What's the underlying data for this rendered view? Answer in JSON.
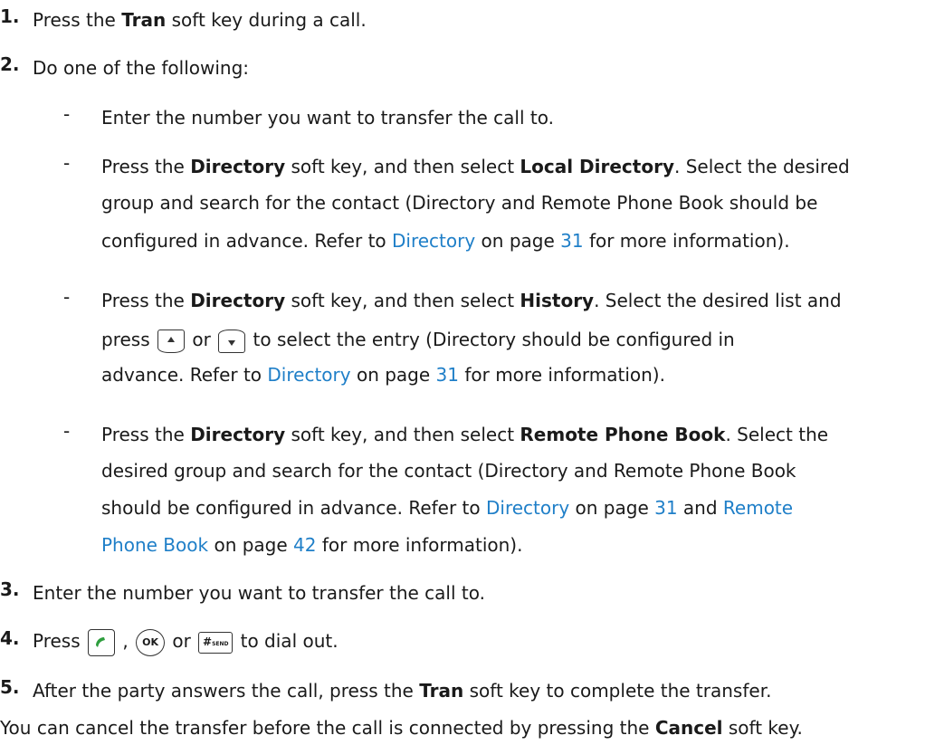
{
  "steps": {
    "s1": {
      "num": "1.",
      "pre": "Press the ",
      "bold": "Tran",
      "post": " soft key during a call."
    },
    "s2": {
      "num": "2.",
      "text": "Do one of the following:"
    },
    "opt1": {
      "dash": "-",
      "text": "Enter the number you want to transfer the call to."
    },
    "opt2": {
      "dash": "-",
      "l1_pre": "Press the ",
      "l1_b1": "Directory",
      "l1_mid": " soft key, and then select ",
      "l1_b2": "Local Directory",
      "l1_post": ". Select the desired",
      "l2": "group and search for the contact (Directory and Remote Phone Book should be",
      "l3_pre": "configured in advance. Refer to ",
      "l3_link": "Directory",
      "l3_mid": " on page ",
      "l3_page": "31",
      "l3_post": " for more information)."
    },
    "opt3": {
      "dash": "-",
      "l1_pre": "Press the ",
      "l1_b1": "Directory",
      "l1_mid": " soft key, and then select ",
      "l1_b2": "History",
      "l1_post": ". Select the desired list and",
      "l2_pre": "press ",
      "l2_or": " or ",
      "l2_post": " to select the entry (Directory should be configured in",
      "l3_pre": "advance. Refer to ",
      "l3_link": "Directory",
      "l3_mid": " on page ",
      "l3_page": "31",
      "l3_post": " for more information)."
    },
    "opt4": {
      "dash": "-",
      "l1_pre": "Press the ",
      "l1_b1": "Directory",
      "l1_mid": " soft key, and then select ",
      "l1_b2": "Remote Phone Book",
      "l1_post": ". Select the",
      "l2": "desired group and search for the contact (Directory and Remote Phone Book",
      "l3_pre": "should be configured in advance. Refer to ",
      "l3_link": "Directory",
      "l3_mid": " on page ",
      "l3_page": "31",
      "l3_and": " and ",
      "l3_link2": "Remote",
      "l4_link": "Phone Book",
      "l4_mid": " on page ",
      "l4_page": "42",
      "l4_post": " for more information)."
    },
    "s3": {
      "num": "3.",
      "text": "Enter the number you want to transfer the call to."
    },
    "s4": {
      "num": "4.",
      "pre": "Press ",
      "comma": " , ",
      "ok": "OK",
      "or": " or ",
      "hash": "#",
      "hash_sub": "SEND",
      "post": " to dial out."
    },
    "s5": {
      "num": "5.",
      "pre": "After the party answers the call, press the ",
      "bold": "Tran",
      "post": " soft key to complete the transfer."
    }
  },
  "footer": {
    "pre": "You can cancel the transfer before the call is connected by pressing the ",
    "bold": "Cancel",
    "post": " soft key."
  },
  "colors": {
    "link": "#1f7fc8",
    "text": "#1a1a1a"
  }
}
